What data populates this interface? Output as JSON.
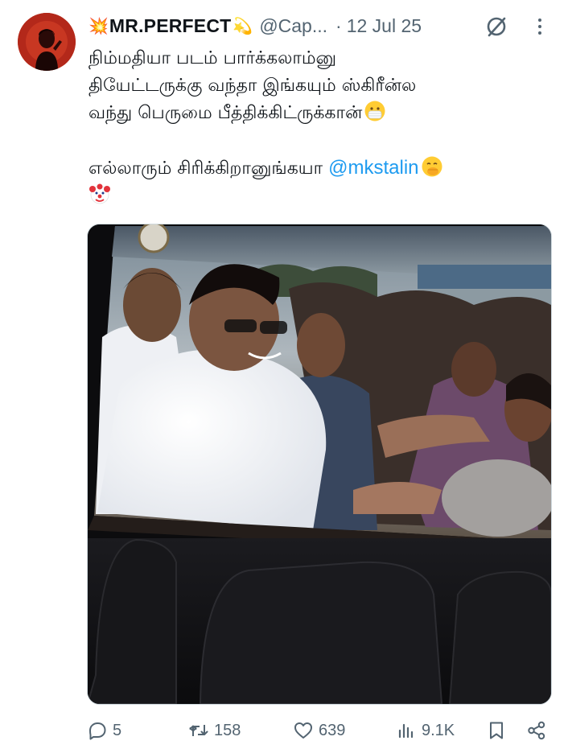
{
  "tweet": {
    "author": {
      "display_name": "MR.PERFECT",
      "name_prefix_emoji": "💥",
      "name_suffix_emoji": "💫",
      "handle": "@Cap...",
      "avatar_icon": "avatar-silhouette-icon"
    },
    "separator": "·",
    "date": "12 Jul 25",
    "header_icons": [
      "grok-no-sign-icon",
      "more-vertical-icon"
    ],
    "text_lines": [
      "நிம்மதியா படம் பார்க்கலாம்னு",
      "தியேட்டருக்கு வந்தா இங்கயும் ஸ்கிரீன்ல",
      "வந்து பெருமை பீத்திக்கிட்ருக்கான்"
    ],
    "text_line3_emoji": "mask-face-emoji",
    "text_line4": "எல்லாரும் சிரிக்கிறானுங்கயா",
    "mention": "@mkstalin",
    "text_line4_emoji": "hand-over-mouth-emoji",
    "text_line5_emoji": "clown-face-emoji",
    "media": {
      "description_icon": "theater-screen-photo"
    },
    "actions": {
      "reply_count": "5",
      "repost_count": "158",
      "like_count": "639",
      "views_count": "9.1K"
    },
    "colors": {
      "text": "#0f1419",
      "secondary": "#536471",
      "link": "#1d9bf0"
    }
  }
}
